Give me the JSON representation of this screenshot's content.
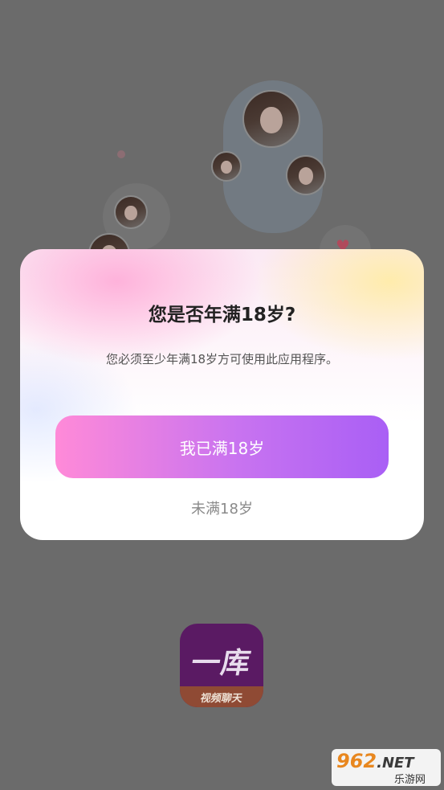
{
  "dialog": {
    "title": "您是否年满18岁?",
    "message": "您必须至少年满18岁方可使用此应用程序。",
    "confirm_label": "我已满18岁",
    "decline_label": "未满18岁"
  },
  "app_logo": {
    "name": "一库",
    "subtitle": "视频聊天"
  },
  "watermark": {
    "number": "962",
    "suffix": ".NET",
    "site_name": "乐游网"
  },
  "icons": {
    "heart": "heart-icon"
  },
  "colors": {
    "overlay": "#6b6b6b",
    "button_gradient_start": "#ff8ad8",
    "button_gradient_end": "#a95ff5",
    "title_text": "#222222",
    "decline_text": "#8a8a8a"
  }
}
